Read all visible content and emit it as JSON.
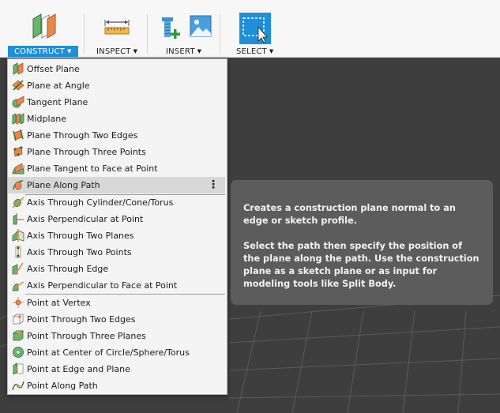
{
  "toolbar": {
    "construct_label": "CONSTRUCT",
    "inspect_label": "INSPECT",
    "insert_label": "INSERT",
    "select_label": "SELECT"
  },
  "menu": {
    "items": [
      "Offset Plane",
      "Plane at Angle",
      "Tangent Plane",
      "Midplane",
      "Plane Through Two Edges",
      "Plane Through Three Points",
      "Plane Tangent to Face at Point",
      "Plane Along Path",
      "Axis Through Cylinder/Cone/Torus",
      "Axis Perpendicular at Point",
      "Axis Through Two Planes",
      "Axis Through Two Points",
      "Axis Through Edge",
      "Axis Perpendicular to Face at Point",
      "Point at Vertex",
      "Point Through Two Edges",
      "Point Through Three Planes",
      "Point at Center of Circle/Sphere/Torus",
      "Point at Edge and Plane",
      "Point Along Path"
    ],
    "highlighted": "Plane Along Path",
    "more_glyph": "⋮"
  },
  "tooltip": {
    "line1": "Creates a construction plane normal to an edge or sketch profile.",
    "line2": "Select the path then specify the position of the plane along the path. Use the construction plane as a sketch plane or as input for modeling tools like Split Body."
  },
  "colors": {
    "accent": "#1f8fd9",
    "plane_orange": "#e8884a",
    "plane_green": "#5aa85a",
    "tooltip_bg": "#5c5c5c",
    "canvas_bg": "#3e3e3e"
  }
}
